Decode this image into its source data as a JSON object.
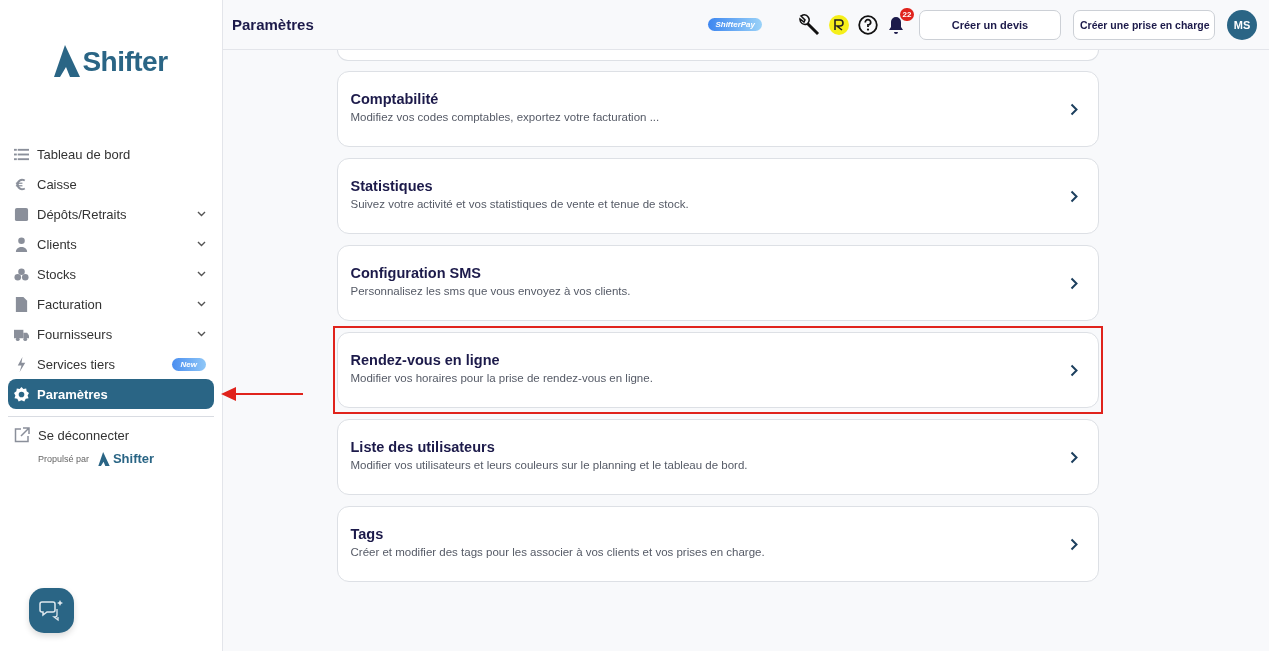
{
  "sidebar": {
    "logo": "Shifter",
    "items": [
      {
        "label": "Tableau de bord",
        "expandable": false,
        "selected": false
      },
      {
        "label": "Caisse",
        "expandable": false,
        "selected": false
      },
      {
        "label": "Dépôts/Retraits",
        "expandable": true,
        "selected": false
      },
      {
        "label": "Clients",
        "expandable": true,
        "selected": false
      },
      {
        "label": "Stocks",
        "expandable": true,
        "selected": false
      },
      {
        "label": "Facturation",
        "expandable": true,
        "selected": false
      },
      {
        "label": "Fournisseurs",
        "expandable": true,
        "selected": false
      },
      {
        "label": "Services tiers",
        "expandable": false,
        "selected": false,
        "badge": "New"
      },
      {
        "label": "Paramètres",
        "expandable": false,
        "selected": true
      }
    ],
    "logout": "Se déconnecter",
    "powered_by": "Propulsé par",
    "powered_logo": "Shifter"
  },
  "header": {
    "title": "Paramètres",
    "pay_badge": "ShifterPay",
    "notification_count": "22",
    "buttons": [
      "Créer un devis",
      "Créer une prise en charge"
    ],
    "avatar": "MS"
  },
  "cards": [
    {
      "title": "Comptabilité",
      "description": "Modifiez vos codes comptables, exportez votre facturation ...",
      "highlighted": false
    },
    {
      "title": "Statistiques",
      "description": "Suivez votre activité et vos statistiques de vente et tenue de stock.",
      "highlighted": false
    },
    {
      "title": "Configuration SMS",
      "description": "Personnalisez les sms que vous envoyez à vos clients.",
      "highlighted": false
    },
    {
      "title": "Rendez-vous en ligne",
      "description": "Modifier vos horaires pour la prise de rendez-vous en ligne.",
      "highlighted": true
    },
    {
      "title": "Liste des utilisateurs",
      "description": "Modifier vos utilisateurs et leurs couleurs sur le planning et le tableau de bord.",
      "highlighted": false
    },
    {
      "title": "Tags",
      "description": "Créer et modifier des tags pour les associer à vos clients et vos prises en charge.",
      "highlighted": false
    }
  ]
}
